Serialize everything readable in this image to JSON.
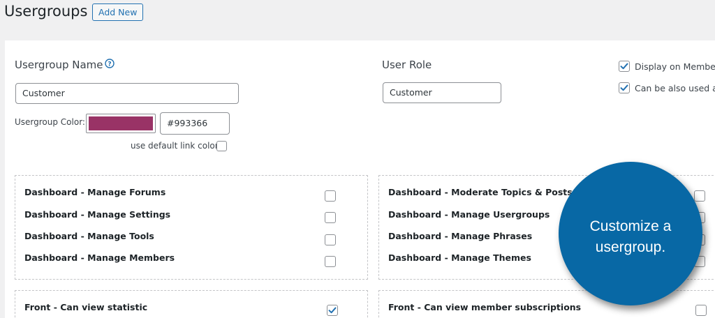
{
  "page": {
    "title": "Usergroups",
    "add_new": "Add New"
  },
  "form": {
    "name_label": "Usergroup Name",
    "name_value": "Customer",
    "role_label": "User Role",
    "role_value": "Customer",
    "color_label": "Usergroup Color:",
    "color_hex": "#993366",
    "swatch_color": "#993366",
    "default_link_label": "use default link color",
    "default_link_checked": false
  },
  "options": [
    {
      "label": "Display on Members",
      "checked": true
    },
    {
      "label": "Can be also used as",
      "checked": true
    }
  ],
  "permissions": {
    "dashboard_left": [
      {
        "label": "Dashboard - Manage Forums",
        "checked": false
      },
      {
        "label": "Dashboard - Manage Settings",
        "checked": false
      },
      {
        "label": "Dashboard - Manage Tools",
        "checked": false
      },
      {
        "label": "Dashboard - Manage Members",
        "checked": false
      }
    ],
    "dashboard_right": [
      {
        "label": "Dashboard - Moderate Topics & Posts",
        "checked": false
      },
      {
        "label": "Dashboard - Manage Usergroups",
        "checked": false
      },
      {
        "label": "Dashboard - Manage Phrases",
        "checked": false
      },
      {
        "label": "Dashboard - Manage Themes",
        "checked": false
      }
    ],
    "front_left": [
      {
        "label": "Front - Can view statistic",
        "checked": true
      }
    ],
    "front_right": [
      {
        "label": "Front - Can view member subscriptions",
        "checked": false
      }
    ]
  },
  "callout": {
    "text": "Customize a usergroup."
  },
  "colors": {
    "accent": "#2271b1",
    "callout": "#0868a5",
    "checkbox_check": "#2271b1"
  },
  "icons": {
    "help": "question-circle-icon",
    "check": "checkmark-icon"
  }
}
